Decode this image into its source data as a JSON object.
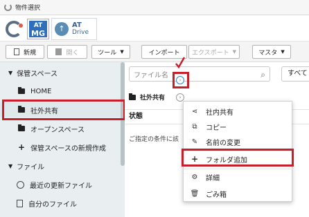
{
  "window": {
    "title": "物件選択"
  },
  "apps": {
    "atmg_line1": "AT",
    "atmg_line2": "MG",
    "drive_line1": "AT",
    "drive_line2": "Drive"
  },
  "toolbar": {
    "new_label": "新規",
    "open_label": "開く",
    "tools_label": "ツール",
    "import_label": "インポート",
    "export_label": "エクスポート",
    "master_label": "マスタ"
  },
  "sidebar": {
    "storage_header": "保管スペース",
    "home": "HOME",
    "shared_external": "社外共有",
    "open_space": "オープンスペース",
    "new_storage": "保管スペースの新規作成",
    "files_header": "ファイル",
    "recent_files": "最近の更新ファイル",
    "my_files": "自分のファイル"
  },
  "main": {
    "search_placeholder": "ファイル名",
    "sort_label": "すべて",
    "breadcrumb": "社外共有",
    "status_header": "状態",
    "empty_message": "ご指定の条件に該"
  },
  "context_menu": {
    "items": [
      {
        "label": "社内共有",
        "icon": "share-icon"
      },
      {
        "label": "コピー",
        "icon": "copy-icon"
      },
      {
        "label": "名前の変更",
        "icon": "edit-icon"
      },
      {
        "label": "フォルダ追加",
        "icon": "plus-icon"
      },
      {
        "label": "詳細",
        "icon": "gear-icon"
      },
      {
        "label": "ごみ箱",
        "icon": "trash-icon"
      }
    ]
  },
  "colors": {
    "highlight_red": "#c81e2b",
    "accent_blue": "#2d7fc1",
    "sidebar_bg": "#e9eff1"
  }
}
